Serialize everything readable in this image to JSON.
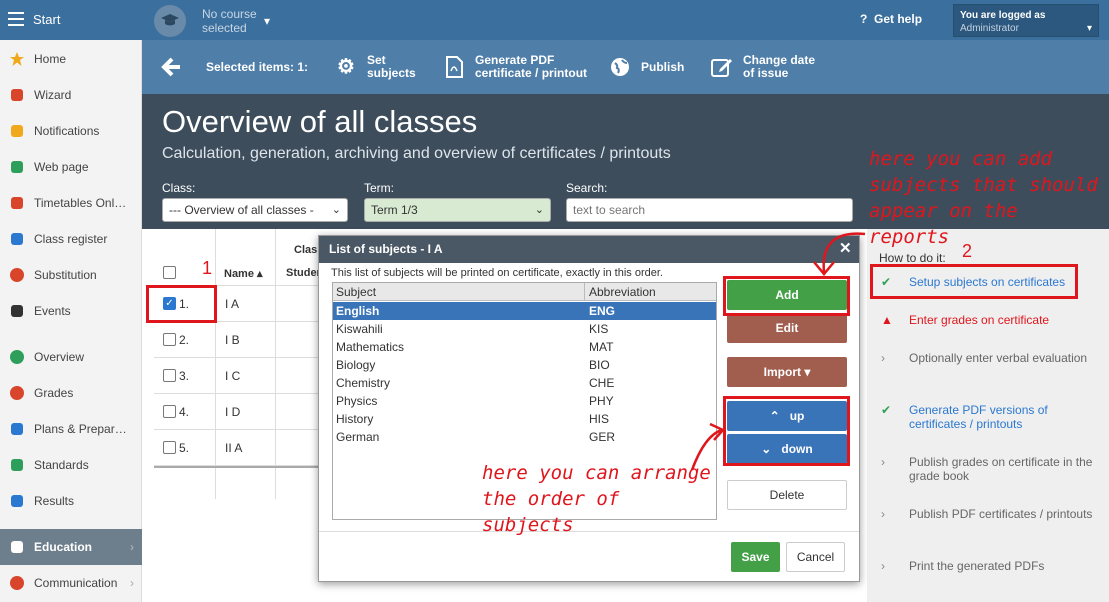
{
  "sidebar": {
    "top_label": "Start",
    "items": [
      {
        "label": "Home",
        "icon": "star-icon",
        "color": "#f0a81c"
      },
      {
        "label": "Wizard",
        "icon": "wand-icon",
        "color": "#d9452b"
      },
      {
        "label": "Notifications",
        "icon": "envelope-icon",
        "color": "#f0a81c"
      },
      {
        "label": "Web page",
        "icon": "home-icon",
        "color": "#2e9e5b"
      },
      {
        "label": "Timetables Onl…",
        "icon": "calendar-icon",
        "color": "#d9452b"
      },
      {
        "label": "Class register",
        "icon": "book-icon",
        "color": "#2b78d0"
      },
      {
        "label": "Substitution",
        "icon": "user-icon",
        "color": "#d9452b"
      },
      {
        "label": "Events",
        "icon": "events-icon",
        "color": "#333333"
      },
      {
        "label": "Overview",
        "icon": "check-circle-icon",
        "color": "#2e9e5b"
      },
      {
        "label": "Grades",
        "icon": "grades-icon",
        "color": "#d9452b"
      },
      {
        "label": "Plans & Prepar…",
        "icon": "plans-icon",
        "color": "#2b78d0"
      },
      {
        "label": "Standards",
        "icon": "shield-icon",
        "color": "#2e9e5b"
      },
      {
        "label": "Results",
        "icon": "bar-chart-icon",
        "color": "#2b78d0"
      },
      {
        "label": "Education",
        "icon": "open-book-icon",
        "color": "#ffffff"
      },
      {
        "label": "Communication",
        "icon": "chat-icon",
        "color": "#d9452b"
      }
    ]
  },
  "topbar": {
    "course_label_1": "No course",
    "course_label_2": "selected",
    "help_label": "Get help",
    "logged_line1": "You are logged as",
    "logged_line2": "Administrator"
  },
  "toolbar": {
    "selected_label": "Selected items: 1:",
    "set_subjects_1": "Set",
    "set_subjects_2": "subjects",
    "pdf_1": "Generate PDF",
    "pdf_2": "certificate / printout",
    "publish": "Publish",
    "date_1": "Change date",
    "date_2": "of issue"
  },
  "header": {
    "title": "Overview of all classes",
    "subtitle": "Calculation, generation, archiving and overview of certificates / printouts",
    "class_label": "Class:",
    "class_value": "--- Overview of all classes -",
    "term_label": "Term:",
    "term_value": "Term 1/3",
    "search_label": "Search:",
    "search_placeholder": "text to search"
  },
  "table": {
    "col_class": "Clas",
    "col_name": "Name ▴",
    "col_student": "Studen",
    "rows": [
      {
        "num": "1.",
        "name": "I A",
        "checked": true
      },
      {
        "num": "2.",
        "name": "I B",
        "checked": false
      },
      {
        "num": "3.",
        "name": "I C",
        "checked": false
      },
      {
        "num": "4.",
        "name": "I D",
        "checked": false
      },
      {
        "num": "5.",
        "name": "II A",
        "checked": false
      }
    ]
  },
  "modal": {
    "title": "List of subjects - I A",
    "note": "This list of subjects will be printed on certificate, exactly in this order.",
    "col_subject": "Subject",
    "col_abbr": "Abbreviation",
    "subjects": [
      {
        "name": "English",
        "abbr": "ENG"
      },
      {
        "name": "Kiswahili",
        "abbr": "KIS"
      },
      {
        "name": "Mathematics",
        "abbr": "MAT"
      },
      {
        "name": "Biology",
        "abbr": "BIO"
      },
      {
        "name": "Chemistry",
        "abbr": "CHE"
      },
      {
        "name": "Physics",
        "abbr": "PHY"
      },
      {
        "name": "History",
        "abbr": "HIS"
      },
      {
        "name": "German",
        "abbr": "GER"
      }
    ],
    "add": "Add",
    "edit": "Edit",
    "import": "Import ▾",
    "up": "up",
    "down": "down",
    "delete": "Delete",
    "save": "Save",
    "cancel": "Cancel"
  },
  "howto": {
    "heading": "How to do it:",
    "steps": [
      {
        "text": "Setup subjects on certificates",
        "state": "done"
      },
      {
        "text": "Enter grades on certificate",
        "state": "warning"
      },
      {
        "text": "Optionally enter verbal evaluation",
        "state": "todo"
      },
      {
        "text": "Generate PDF versions of certificates / printouts",
        "state": "done"
      },
      {
        "text": "Publish grades on certificate in the grade book",
        "state": "todo"
      },
      {
        "text": "Publish PDF certificates / printouts",
        "state": "todo"
      },
      {
        "text": "Print the generated PDFs",
        "state": "todo"
      }
    ]
  },
  "annotations": {
    "add_note": "here you can add subjects that should appear on the reports",
    "order_note": "here you can arrange the order of subjects",
    "num1": "1",
    "num2": "2",
    "color": "#e0161d"
  }
}
